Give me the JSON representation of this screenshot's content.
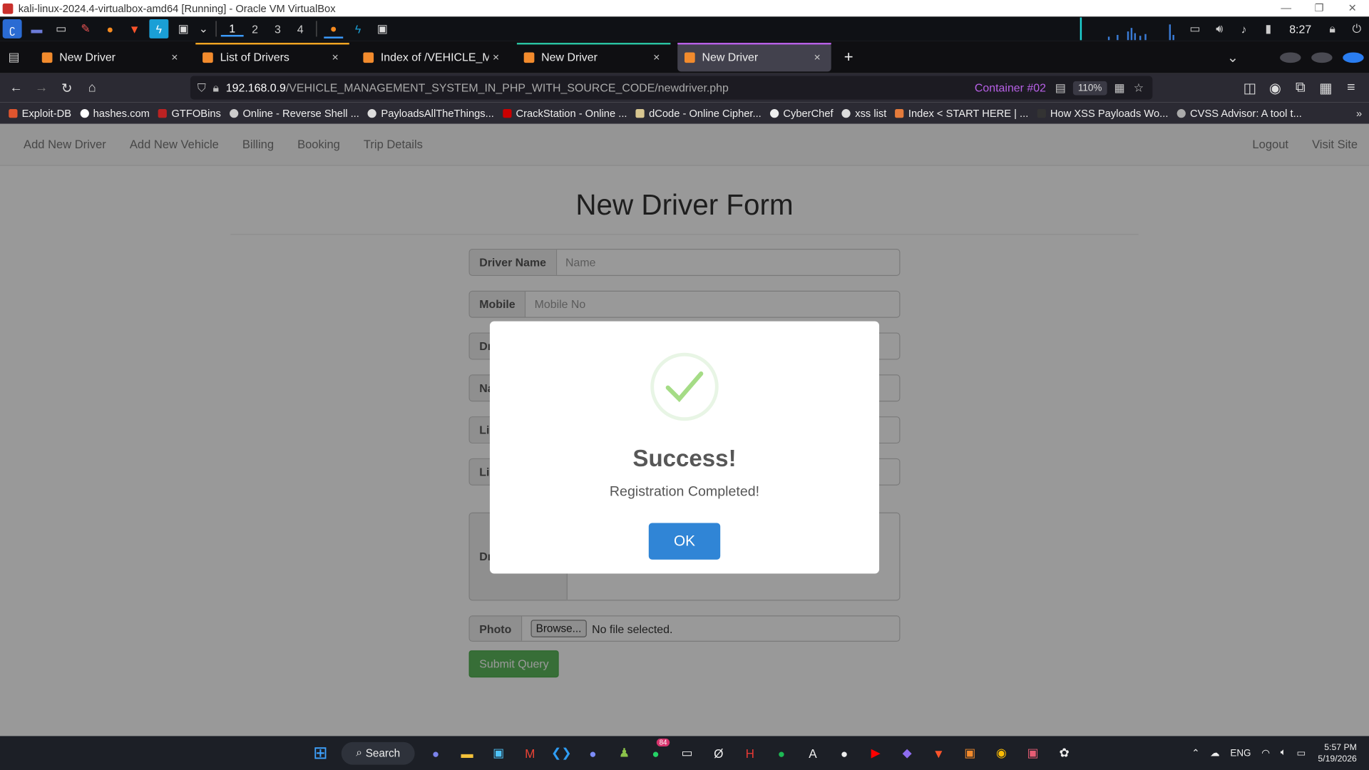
{
  "vbox": {
    "title": "kali-linux-2024.4-virtualbox-amd64 [Running] - Oracle VM VirtualBox"
  },
  "kali_panel": {
    "workspaces": [
      "1",
      "2",
      "3",
      "4"
    ],
    "clock": "8:27"
  },
  "tabs": [
    {
      "title": "New Driver",
      "close": "×"
    },
    {
      "title": "List of Drivers",
      "close": "×"
    },
    {
      "title": "Index of /VEHICLE_MANAGEMENT_SYSTEM_IN_PHP",
      "close": "×"
    },
    {
      "title": "New Driver",
      "close": "×"
    },
    {
      "title": "New Driver",
      "close": "×"
    }
  ],
  "urlbar": {
    "host": "192.168.0.9",
    "path": "/VEHICLE_MANAGEMENT_SYSTEM_IN_PHP_WITH_SOURCE_CODE/newdriver.php",
    "container": "Container #02",
    "zoom": "110%"
  },
  "bookmarks": [
    "Exploit-DB",
    "hashes.com",
    "GTFOBins",
    "Online - Reverse Shell ...",
    "PayloadsAllTheThings...",
    "CrackStation - Online ...",
    "dCode - Online Cipher...",
    "CyberChef",
    "xss list",
    "Index < START HERE | ...",
    "How XSS Payloads Wo...",
    "CVSS Advisor: A tool t..."
  ],
  "site_nav": {
    "left": [
      "Add New Driver",
      "Add New Vehicle",
      "Billing",
      "Booking",
      "Trip Details"
    ],
    "right": [
      "Logout",
      "Visit Site"
    ]
  },
  "form": {
    "heading": "New Driver Form",
    "fields": [
      {
        "label": "Driver Name",
        "placeholder": "Name"
      },
      {
        "label": "Mobile",
        "placeholder": "Mobile No"
      },
      {
        "label": "Dr",
        "placeholder": ""
      },
      {
        "label": "Na",
        "placeholder": ""
      },
      {
        "label": "Li",
        "placeholder": ""
      },
      {
        "label": "Li",
        "placeholder": ""
      }
    ],
    "textarea_label": "Dr",
    "photo_label": "Photo",
    "browse": "Browse...",
    "no_file": "No file selected.",
    "submit": "Submit Query"
  },
  "modal": {
    "title": "Success!",
    "text": "Registration Completed!",
    "ok": "OK"
  },
  "taskbar": {
    "search": "Search",
    "whatsapp_badge": "84",
    "lang": "ENG",
    "time": "5:57 PM",
    "date": "5/19/2026"
  },
  "colors": {
    "accent": "#3085d6",
    "success": "#a5dc86",
    "submit": "#5cb85c"
  }
}
